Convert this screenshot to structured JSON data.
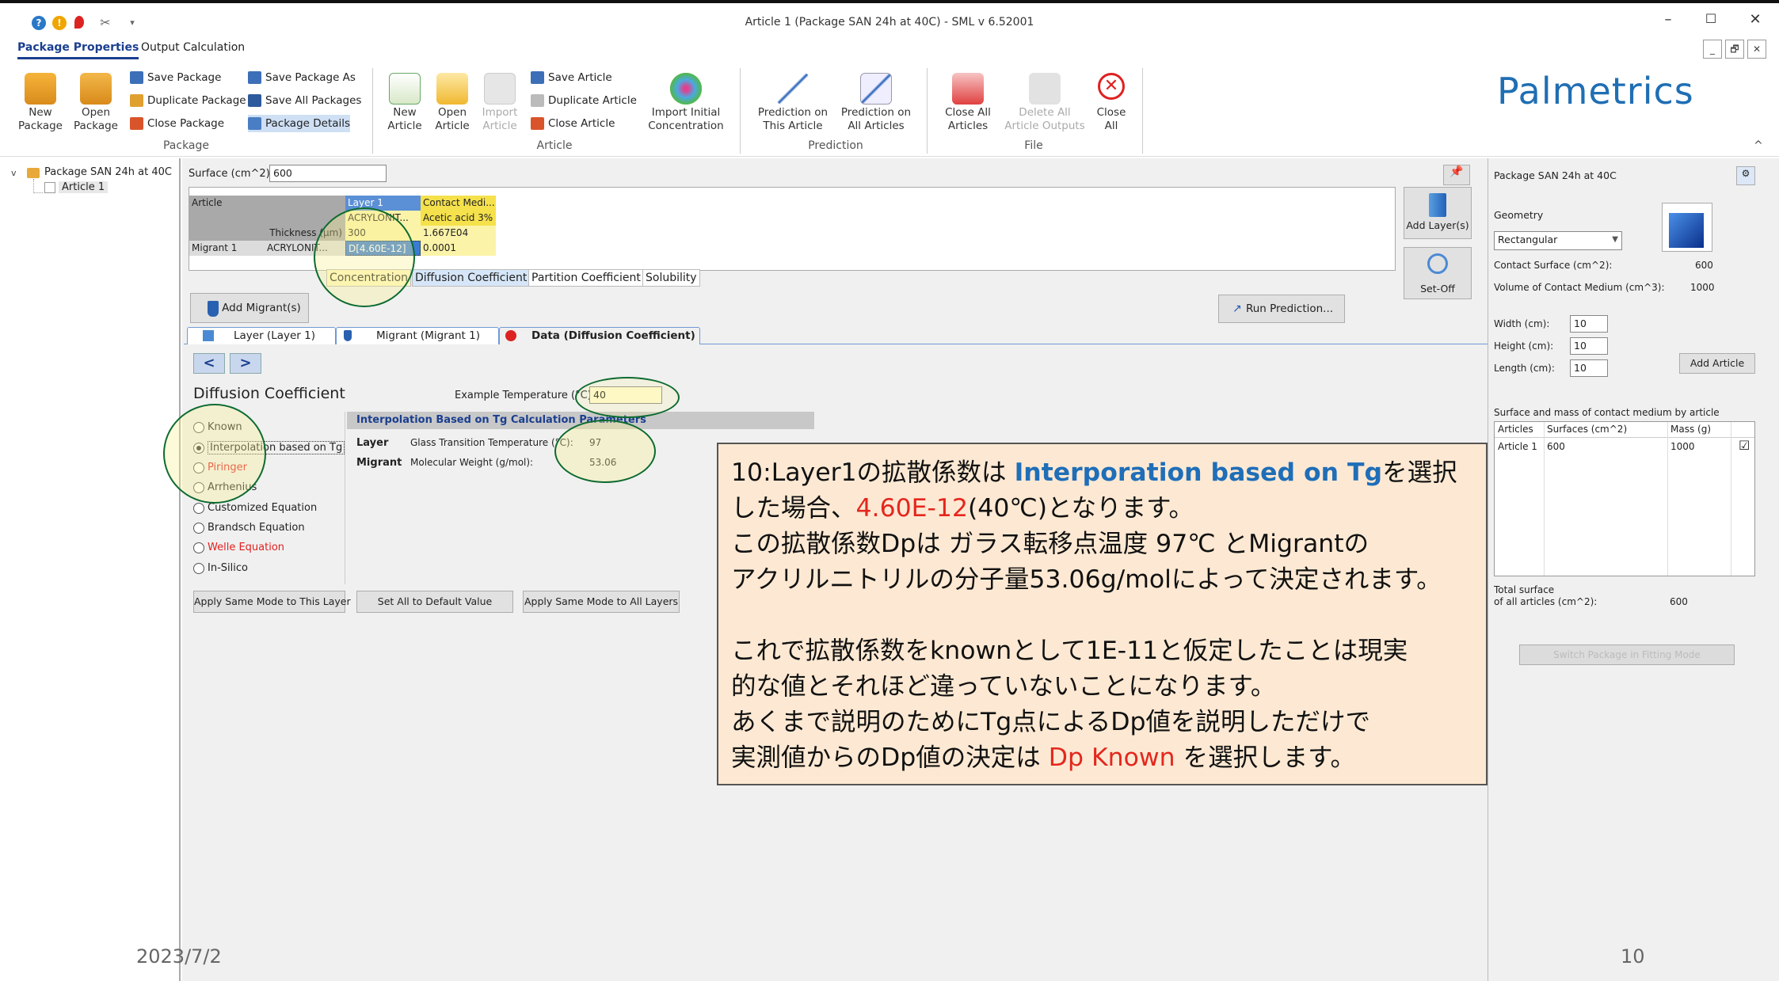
{
  "window": {
    "title": "Article 1 (Package SAN 24h at 40C) - SML v 6.52001",
    "min": "–",
    "max": "☐",
    "close": "✕",
    "mdi_min": "_",
    "mdi_restore": "🗗",
    "mdi_close": "✕"
  },
  "quick_access": {
    "help": "?",
    "dropdown": "▾"
  },
  "menu_tabs": [
    "Package Properties",
    "Output Calculation"
  ],
  "ribbon": {
    "new_package": [
      "New",
      "Package"
    ],
    "open_package": [
      "Open",
      "Package"
    ],
    "save_package": "Save Package",
    "duplicate_package": "Duplicate Package",
    "close_package": "Close Package",
    "save_package_as": "Save Package As",
    "save_all_packages": "Save All Packages",
    "package_details": "Package Details",
    "group_package": "Package",
    "new_article": [
      "New",
      "Article"
    ],
    "open_article": [
      "Open",
      "Article"
    ],
    "import_article": [
      "Import",
      "Article"
    ],
    "save_article": "Save Article",
    "duplicate_article": "Duplicate Article",
    "close_article": "Close Article",
    "import_initial": [
      "Import Initial",
      "Concentration"
    ],
    "group_article": "Article",
    "prediction_this": [
      "Prediction on",
      "This Article"
    ],
    "prediction_all": [
      "Prediction on",
      "All Articles"
    ],
    "group_prediction": "Prediction",
    "close_all_articles": [
      "Close All",
      "Articles"
    ],
    "delete_all_outputs": [
      "Delete All",
      "Article Outputs"
    ],
    "close_all": [
      "Close",
      "All"
    ],
    "group_file": "File",
    "collapse": "^"
  },
  "logo": "Palmetrics",
  "tree": {
    "package": "Package SAN 24h at 40C",
    "article": "Article 1",
    "expand": "v"
  },
  "surface": {
    "label": "Surface (cm^2)",
    "value": "600"
  },
  "grid": {
    "article": "Article",
    "layer_hdr": "Layer 1",
    "contact_hdr": "Contact Medi...",
    "layer_mat": "ACRYLONIT...",
    "contact_mat": "Acetic acid 3%",
    "thickness_lbl": "Thickness (µm)",
    "thickness_val": "300",
    "contact_val": "1.667E04",
    "migrant": "Migrant 1",
    "migrant_mat": "ACRYLONIT...",
    "migrant_d": "D[4.60E-12]",
    "migrant_contact": "0.0001"
  },
  "subtabs": [
    "Concentration",
    "Diffusion Coefficient",
    "Partition Coefficient",
    "Solubility"
  ],
  "buttons": {
    "add_layers": "Add Layer(s)",
    "set_off": "Set-Off",
    "add_migrants": "Add Migrant(s)",
    "run_prediction": "Run Prediction...",
    "apply_layer": "Apply Same Mode to This Layer",
    "set_default": "Set All to Default Value",
    "apply_all": "Apply Same Mode to All Layers",
    "add_article": "Add Article",
    "switch_fitting": "Switch Package in Fitting Mode"
  },
  "panel_tabs": [
    "Layer (Layer 1)",
    "Migrant (Migrant 1)",
    "Data (Diffusion Coefficient)"
  ],
  "nav": {
    "prev": "<",
    "next": ">"
  },
  "diffusion": {
    "title": "Diffusion Coefficient",
    "example_temp_label": "Example Temperature (°C):",
    "example_temp_value": "40",
    "modes": [
      "Known",
      "Interpolation based on Tg",
      "Piringer",
      "Arrhenius",
      "Customized Equation",
      "Brandsch Equation",
      "Welle Equation",
      "In-Silico"
    ],
    "interp_header": "Interpolation Based on Tg Calculation Parameters",
    "layer_label": "Layer",
    "tg_label": "Glass Transition Temperature (°C):",
    "tg_value": "97",
    "migrant_label": "Migrant",
    "mw_label": "Molecular Weight (g/mol):",
    "mw_value": "53.06"
  },
  "right": {
    "package": "Package SAN 24h at 40C",
    "geometry_label": "Geometry",
    "geometry_value": "Rectangular",
    "contact_surface_label": "Contact Surface (cm^2):",
    "contact_surface_value": "600",
    "volume_label": "Volume of Contact Medium (cm^3):",
    "volume_value": "1000",
    "width_label": "Width (cm):",
    "width_value": "10",
    "height_label": "Height (cm):",
    "height_value": "10",
    "length_label": "Length (cm):",
    "length_value": "10",
    "table_title": "Surface and mass of contact medium by article",
    "col_articles": "Articles",
    "col_surfaces": "Surfaces (cm^2)",
    "col_mass": "Mass (g)",
    "row_article": "Article 1",
    "row_surface": "600",
    "row_mass": "1000",
    "row_check": "☑",
    "total_label_1": "Total surface",
    "total_label_2": "of all articles (cm^2):",
    "total_value": "600"
  },
  "note": {
    "l1a": "10:Layer1の拡散係数は  ",
    "l1b": "Interporation based on Tg",
    "l1c": "を選択",
    "l2a": "した場合、",
    "l2b": "4.60E-12",
    "l2c": "(40℃)となります。",
    "l3": "この拡散係数Dpは  ガラス転移点温度  97℃  とMigrantの",
    "l4": "アクリルニトリルの分子量53.06g/molによって決定されます。",
    "l5": "これで拡散係数をknownとして1E-11と仮定したことは現実",
    "l6": "的な値とそれほど違っていないことになります。",
    "l7": "あくまで説明のためにTg点によるDp値を説明しただけで",
    "l8a": "実測値からのDp値の決定は  ",
    "l8b": "Dp  Known",
    "l8c": "  を選択します。"
  },
  "footer": {
    "date": "2023/7/2",
    "page": "10"
  },
  "colors": {
    "accent": "#1b3f8f",
    "logo": "#1f6eb3",
    "note_bg": "#fde9d3",
    "highlight_red": "#e4271e",
    "highlight_blue": "#1f6eb8"
  }
}
